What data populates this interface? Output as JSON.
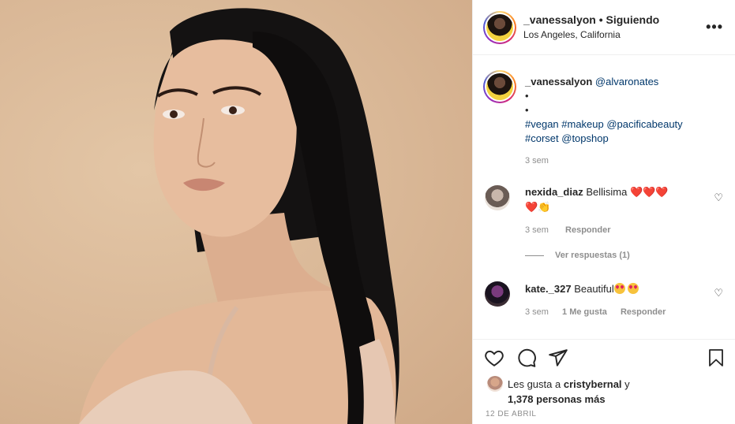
{
  "post": {
    "username": "_vanessalyon",
    "follow_status": "Siguiendo",
    "separator": "•",
    "location": "Los Angeles, California",
    "more_icon": "more-horizontal-icon",
    "photo_alt": "Retrato de mujer con cabello largo negro sobre fondo beige"
  },
  "caption": {
    "username": "_vanessalyon",
    "mention": "@alvaronates",
    "bullet1": "•",
    "bullet2": "•",
    "line3": "#vegan #makeup @pacificabeauty",
    "line4": "#corset @topshop",
    "time": "3 sem"
  },
  "comments": [
    {
      "username": "nexida_diaz",
      "text": "Bellisima",
      "emoji_line1": "❤️❤️❤️",
      "emoji_line2": "❤️👏",
      "time": "3 sem",
      "reply": "Responder",
      "view_replies": "Ver respuestas (1)"
    },
    {
      "username": "kate._327",
      "text": "Beautiful",
      "time": "3 sem",
      "likes": "1 Me gusta",
      "reply": "Responder"
    }
  ],
  "actions": {
    "liked_by_prefix": "Les gusta a",
    "liked_by_user": "cristybernal",
    "liked_by_conj": "y",
    "likes_count": "1,378 personas más",
    "date": "12 DE ABRIL"
  },
  "colors": {
    "link": "#00376b",
    "muted": "#8e8e8e",
    "border": "#efefef",
    "heart": "#e0245e"
  }
}
